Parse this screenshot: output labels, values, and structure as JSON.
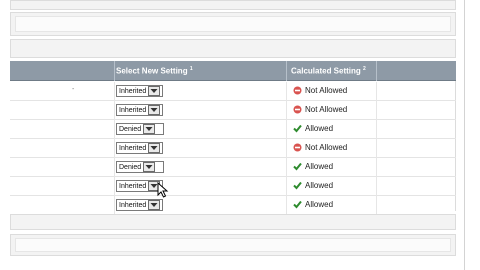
{
  "grid": {
    "columns": [
      {
        "label": "Select New Setting",
        "footnote": "1"
      },
      {
        "label": "Calculated Setting",
        "footnote": "2"
      }
    ],
    "first_row_dash": "-",
    "rows": [
      {
        "select": "Inherited",
        "calculated": "Not Allowed",
        "status": "not-allowed"
      },
      {
        "select": "Inherited",
        "calculated": "Not Allowed",
        "status": "not-allowed"
      },
      {
        "select": "Denied",
        "calculated": "Allowed",
        "status": "allowed"
      },
      {
        "select": "Inherited",
        "calculated": "Not Allowed",
        "status": "not-allowed"
      },
      {
        "select": "Denied",
        "calculated": "Allowed",
        "status": "allowed"
      },
      {
        "select": "Inherited",
        "calculated": "Allowed",
        "status": "allowed"
      },
      {
        "select": "Inherited",
        "calculated": "Allowed",
        "status": "allowed"
      }
    ]
  },
  "colors": {
    "header_bg": "#8e9aa6",
    "not_allowed": "#d9534f",
    "allowed": "#2e8b2e"
  },
  "icons": {
    "not_allowed": "no-entry-icon",
    "allowed": "checkmark-icon",
    "select_button": "dropdown-icon",
    "cursor": "mouse-pointer-icon"
  }
}
